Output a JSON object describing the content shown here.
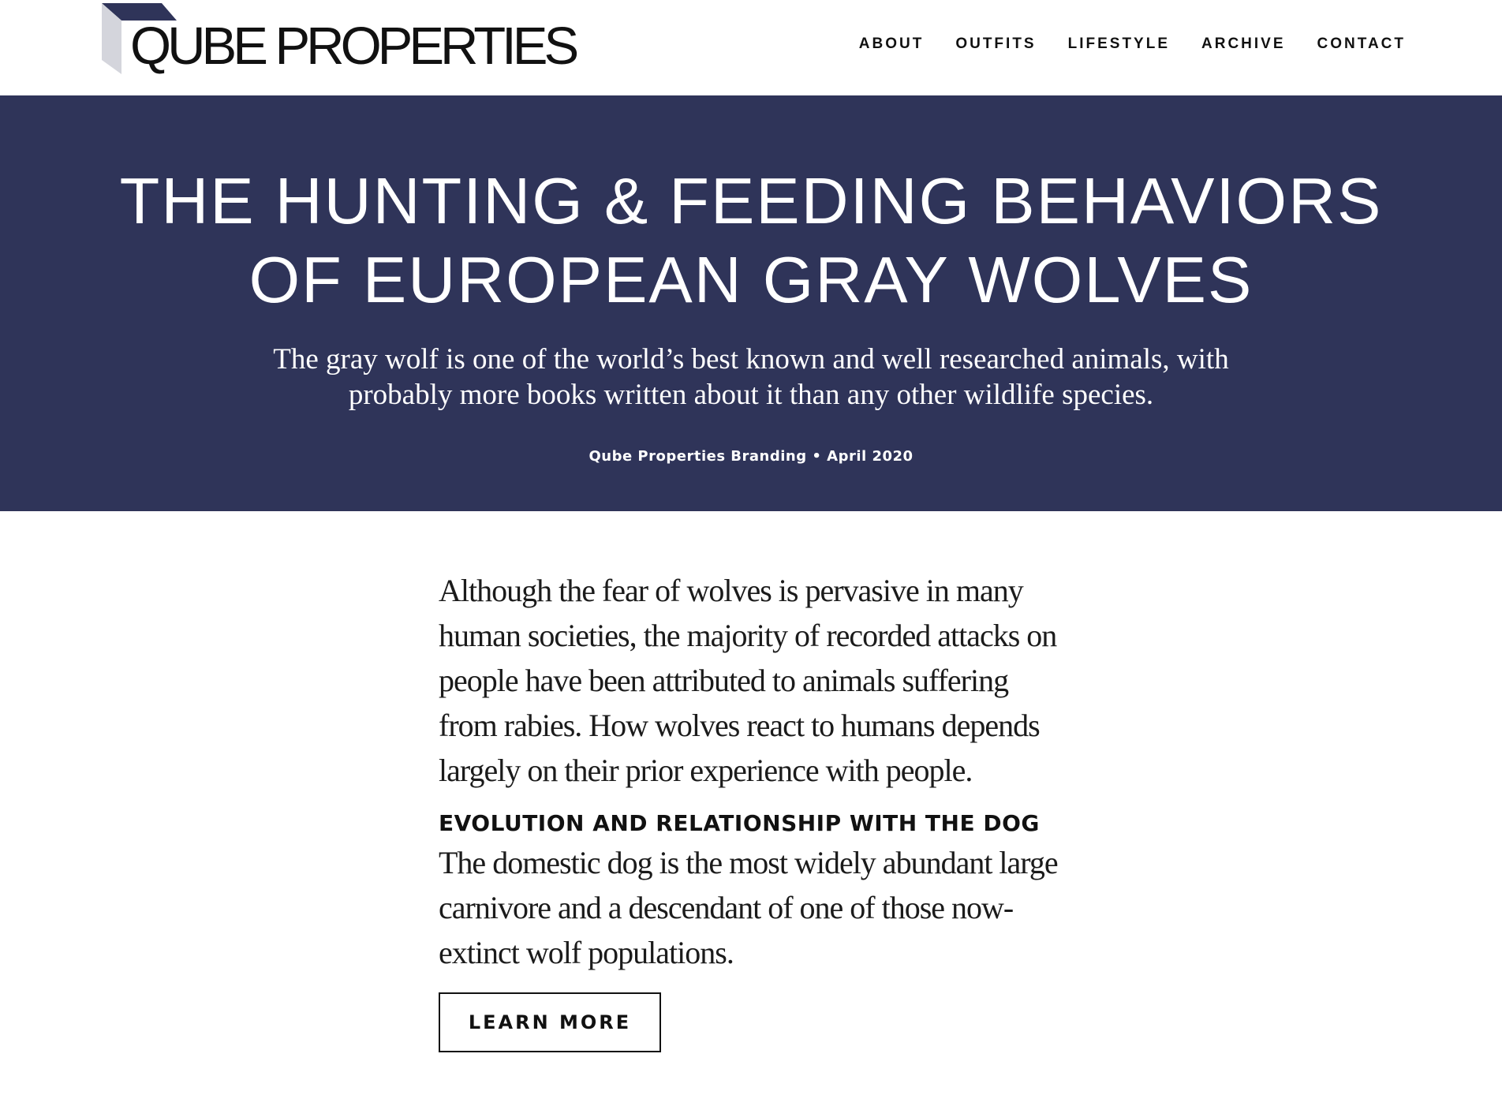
{
  "brand": {
    "name": "QUBE PROPERTIES",
    "logo_icon": "cube-icon",
    "colors": {
      "cube_top": "#2f3459",
      "cube_side": "#d4d5dc"
    }
  },
  "nav": {
    "items": [
      {
        "label": "ABOUT"
      },
      {
        "label": "OUTFITS"
      },
      {
        "label": "LIFESTYLE"
      },
      {
        "label": "ARCHIVE"
      },
      {
        "label": "CONTACT"
      }
    ]
  },
  "hero": {
    "title": "THE HUNTING & FEEDING BEHAVIORS OF EUROPEAN GRAY WOLVES",
    "subtitle": "The gray wolf is one of the world’s best known and well researched animals, with probably more books written about it than any other wildlife species.",
    "meta": "Qube Properties Branding • April 2020",
    "background": "#2f3459"
  },
  "article": {
    "intro": "Although the fear of wolves is pervasive in many human societies, the majority of recorded attacks on people have been attributed to animals suffering from rabies. How wolves react to humans depends largely on their prior experience with people.",
    "section_heading": "EVOLUTION AND RELATIONSHIP WITH THE DOG",
    "section_body": "The domestic dog is the most widely abundant large carnivore and a descendant of one of those now-extinct wolf populations.",
    "button_label": "LEARN MORE"
  }
}
